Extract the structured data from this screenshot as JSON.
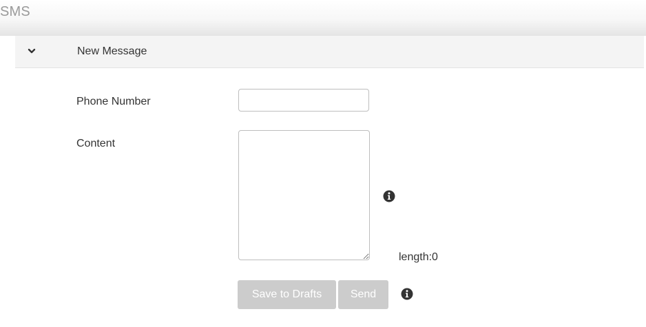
{
  "page": {
    "title": "SMS"
  },
  "panel": {
    "title": "New Message",
    "toggle_icon": "chevron-down-icon"
  },
  "form": {
    "phone_label": "Phone Number",
    "phone_value": "",
    "content_label": "Content",
    "content_value": "",
    "content_info_icon": "info-circle-icon",
    "length_text": "length:0"
  },
  "actions": {
    "save_drafts_label": "Save to Drafts",
    "send_label": "Send",
    "send_info_icon": "info-circle-icon",
    "buttons_disabled": true
  },
  "colors": {
    "title_gray": "#9a9a9a",
    "header_bg": "#f4f4f4",
    "text": "#333333",
    "input_border": "#bdbdbd",
    "button_disabled_bg": "#cccccc",
    "icon": "#333333"
  }
}
